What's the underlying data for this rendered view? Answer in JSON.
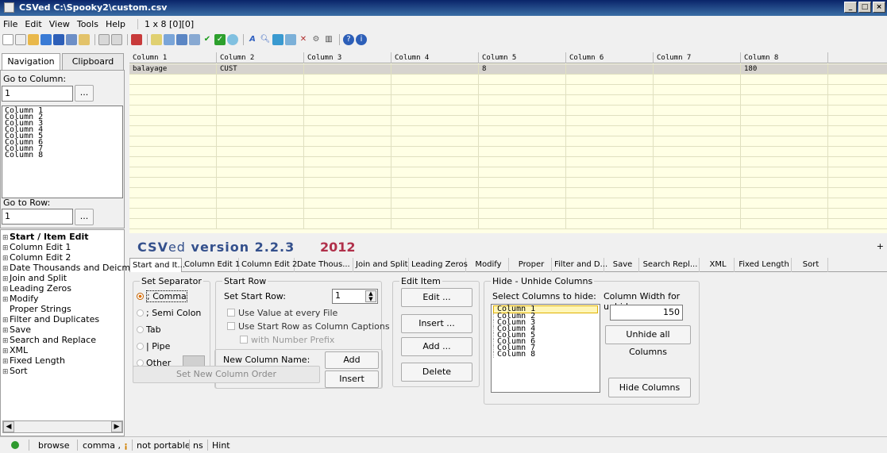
{
  "window": {
    "title": "CSVed C:\\Spooky2\\custom.csv"
  },
  "menu": {
    "items": [
      "File",
      "Edit",
      "View",
      "Tools",
      "Help"
    ],
    "grid_info": "1 x 8 [0][0]"
  },
  "left": {
    "tabs": [
      "Navigation",
      "Clipboard"
    ],
    "go_to_column_label": "Go to Column:",
    "go_to_column_value": "1",
    "go_button": "...",
    "columns": [
      "Column 1",
      "Column 2",
      "Column 3",
      "Column 4",
      "Column 5",
      "Column 6",
      "Column 7",
      "Column 8"
    ],
    "go_to_row_label": "Go to Row:",
    "go_to_row_value": "1",
    "tree": [
      {
        "label": "Start / Item Edit",
        "bold": true,
        "sign": "⊞"
      },
      {
        "label": "Column Edit 1",
        "sign": "⊞"
      },
      {
        "label": "Column Edit 2",
        "sign": "⊞"
      },
      {
        "label": "Date Thousands and Deicm",
        "sign": "⊞"
      },
      {
        "label": "Join and Split",
        "sign": "⊞"
      },
      {
        "label": "Leading Zeros",
        "sign": "⊞"
      },
      {
        "label": "Modify",
        "sign": "⊞"
      },
      {
        "label": "Proper Strings",
        "sign": ""
      },
      {
        "label": "Filter and Duplicates",
        "sign": "⊞"
      },
      {
        "label": "Save",
        "sign": "⊞"
      },
      {
        "label": "Search and Replace",
        "sign": "⊞"
      },
      {
        "label": "XML",
        "sign": "⊞"
      },
      {
        "label": "Fixed Length",
        "sign": "⊞"
      },
      {
        "label": "Sort",
        "sign": "⊞"
      }
    ]
  },
  "grid": {
    "headers": [
      "Column 1",
      "Column 2",
      "Column 3",
      "Column 4",
      "Column 5",
      "Column 6",
      "Column 7",
      "Column 8"
    ],
    "rows": [
      [
        "balayage",
        "CUST",
        "",
        "",
        "8",
        "",
        "",
        "180"
      ]
    ]
  },
  "bottom": {
    "version_csv": "CSV",
    "version_ed": "ed",
    "version_rest": " version 2.2.3",
    "year": "2012",
    "plus": "+",
    "tabs": [
      "Start and It...",
      "Column Edit 1",
      "Column Edit 2",
      "Date Thous...",
      "Join and Split",
      "Leading Zeros",
      "Modify",
      "Proper",
      "Filter and D...",
      "Save",
      "Search Repl...",
      "XML",
      "Fixed Length",
      "Sort"
    ],
    "set_separator": {
      "title": "Set Separator",
      "options": [
        "; Comma",
        "; Semi Colon",
        "Tab",
        "| Pipe",
        "Other"
      ]
    },
    "start_row": {
      "title": "Start Row",
      "set_label": "Set Start Row:",
      "value": "1",
      "use_value": "Use Value at every File",
      "use_captions": "Use Start Row as Column Captions",
      "with_prefix": "with Number Prefix"
    },
    "new_column": {
      "label": "New Column Name:",
      "add": "Add",
      "insert": "Insert",
      "set_order": "Set New Column Order"
    },
    "edit_item": {
      "title": "Edit Item",
      "buttons": [
        "Edit ...",
        "Insert ...",
        "Add ...",
        "Delete"
      ]
    },
    "hide": {
      "title": "Hide - Unhide Columns",
      "select_label": "Select Columns to hide:",
      "width_label": "Column Width for unhide:",
      "width_value": "150",
      "columns": [
        "Column 1",
        "Column 2",
        "Column 3",
        "Column 4",
        "Column 5",
        "Column 6",
        "Column 7",
        "Column 8"
      ],
      "unhide_all": "Unhide all Columns",
      "hide_columns": "Hide Columns"
    }
  },
  "status": {
    "mode": "browse",
    "sep": "comma ,",
    "portable": "not portable",
    "ns": "ns",
    "hint": "Hint"
  },
  "colors": {
    "grid_bg": "#ffffe5",
    "selected_row": "#d6d3ce",
    "version_blue": "#34508c",
    "year_red": "#b0304a"
  }
}
